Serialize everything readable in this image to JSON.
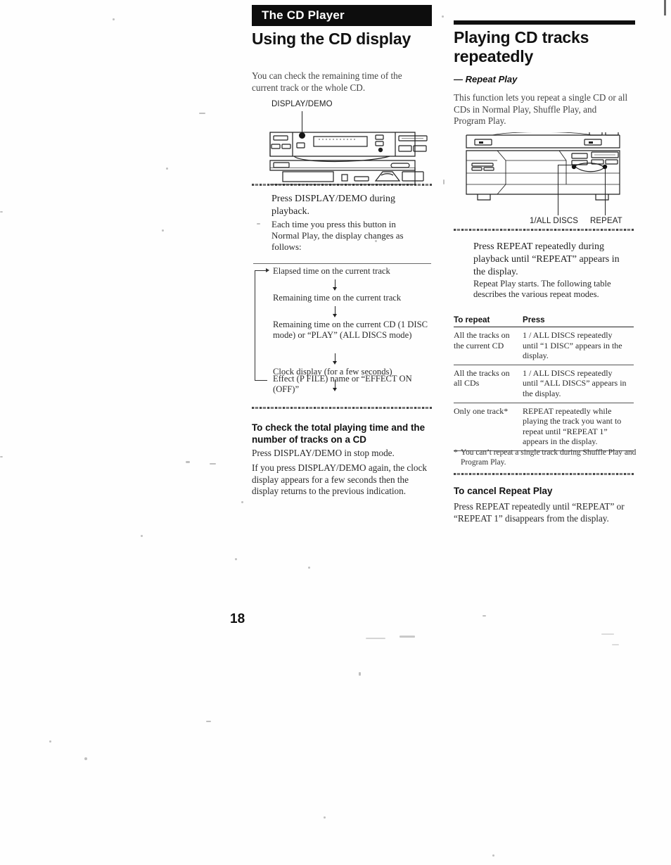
{
  "page": {
    "number": "18",
    "chapter_banner": "The CD Player"
  },
  "left_column": {
    "title": "Using the CD display",
    "intro": "You can check the remaining time of the current track or the whole CD.",
    "diagram": {
      "callout": "DISPLAY/DEMO"
    },
    "step": {
      "instruction": "Press DISPLAY/DEMO during playback.",
      "detail": "Each time you press this button in Normal Play, the display changes as follows:"
    },
    "flow_steps": [
      "Elapsed time on the current track",
      "Remaining time on the current track",
      "Remaining time on the current CD (1 DISC mode) or “PLAY” (ALL DISCS mode)",
      "Clock display (for a few seconds)",
      "Effect (P FILE) name or “EFFECT ON (OFF)”"
    ],
    "total_time_section": {
      "heading": "To check the total playing time and the number of tracks on a CD",
      "para1": "Press DISPLAY/DEMO in stop mode.",
      "para2": "If you press DISPLAY/DEMO again, the clock display appears for a few seconds then the display returns to the previous indication."
    }
  },
  "right_column": {
    "title": "Playing CD tracks repeatedly",
    "subtitle": "— Repeat Play",
    "intro": "This function lets you repeat a single CD or all CDs in Normal Play, Shuffle Play, and Program Play.",
    "diagram": {
      "callout_left": "1/ALL DISCS",
      "callout_right": "REPEAT"
    },
    "step": {
      "instruction": "Press REPEAT repeatedly during playback until “REPEAT” appears in the display.",
      "detail": "Repeat Play starts. The following table describes the various repeat modes."
    },
    "table": {
      "headers": [
        "To repeat",
        "Press"
      ],
      "rows": [
        {
          "to_repeat": "All the tracks on the current CD",
          "press": "1 / ALL DISCS repeatedly until “1 DISC” appears in the display."
        },
        {
          "to_repeat": "All the tracks on all CDs",
          "press": "1 / ALL DISCS repeatedly until “ALL DISCS” appears in the display."
        },
        {
          "to_repeat": "Only one track*",
          "press": "REPEAT repeatedly while playing the track you want to repeat until “REPEAT 1” appears in the display."
        }
      ]
    },
    "footnote_marker": "*",
    "footnote": "You can’t repeat a single track during Shuffle Play and Program Play.",
    "cancel_section": {
      "heading": "To cancel Repeat Play",
      "body": "Press REPEAT repeatedly until “REPEAT” or “REPEAT 1” disappears from the display."
    }
  }
}
